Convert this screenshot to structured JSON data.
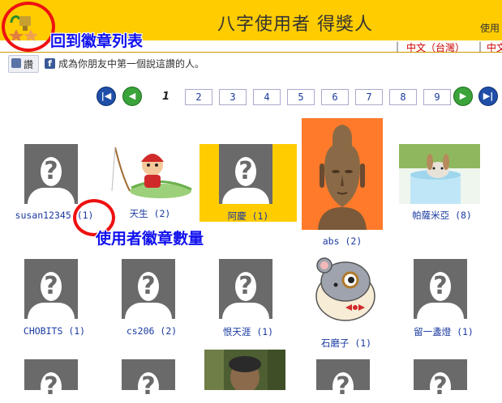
{
  "header": {
    "title": "八字使用者 得獎人",
    "user_partial": "使用",
    "bg_color": "#ffcc00"
  },
  "annotations": {
    "back_label": "回到徽章列表",
    "count_label": "使用者徽章數量",
    "color": "#ee1111"
  },
  "lang": {
    "items": [
      "中文（台灣）",
      "中文"
    ]
  },
  "facebook": {
    "like_label": "讚",
    "prompt": "成為你朋友中第一個說這讚的人。"
  },
  "pager": {
    "current": "1",
    "pages": [
      "2",
      "3",
      "4",
      "5",
      "6",
      "7",
      "8",
      "9"
    ]
  },
  "users": [
    {
      "name": "susan12345",
      "count": "(1)",
      "img": "placeholder"
    },
    {
      "name": "天生",
      "count": "(2)",
      "img": "fisher"
    },
    {
      "name": "阿慶",
      "count": "(1)",
      "img": "placeholder",
      "highlight": true
    },
    {
      "name": "abs",
      "count": "(2)",
      "img": "buddha"
    },
    {
      "name": "帕薩米亞",
      "count": "(8)",
      "img": "rabbit"
    },
    {
      "name": "CHOBITS",
      "count": "(1)",
      "img": "placeholder"
    },
    {
      "name": "cs206",
      "count": "(2)",
      "img": "placeholder"
    },
    {
      "name": "恨天涯",
      "count": "(1)",
      "img": "placeholder"
    },
    {
      "name": "石磨子",
      "count": "(1)",
      "img": "hamster"
    },
    {
      "name": "留一盞燈",
      "count": "(1)",
      "img": "placeholder"
    }
  ]
}
